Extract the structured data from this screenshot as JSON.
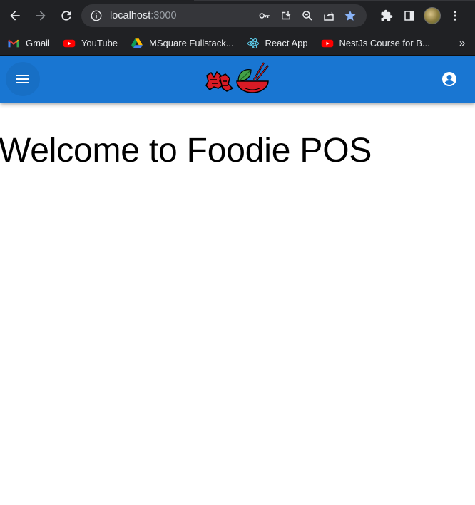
{
  "browser": {
    "url_host": "localhost",
    "url_port": ":3000",
    "bookmarks": [
      {
        "label": "Gmail",
        "icon": "gmail-icon"
      },
      {
        "label": "YouTube",
        "icon": "youtube-icon"
      },
      {
        "label": "MSquare Fullstack...",
        "icon": "google-drive-icon"
      },
      {
        "label": "React App",
        "icon": "react-icon"
      },
      {
        "label": "NestJs Course for B...",
        "icon": "youtube-icon"
      }
    ],
    "more_bookmarks": "»"
  },
  "appbar": {
    "color": "#1976d2",
    "logo_alt": "logo"
  },
  "main": {
    "heading": "Welcome to Foodie POS"
  }
}
